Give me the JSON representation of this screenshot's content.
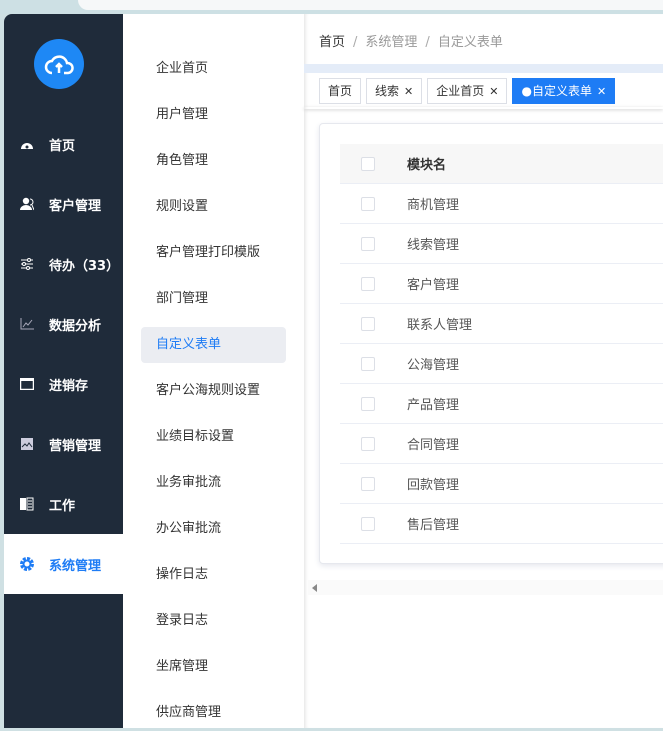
{
  "sidebar": {
    "items": [
      {
        "label": "首页",
        "icon": "dashboard-icon"
      },
      {
        "label": "客户管理",
        "icon": "users-icon"
      },
      {
        "label": "待办（33）",
        "icon": "sliders-icon"
      },
      {
        "label": "数据分析",
        "icon": "chart-line-icon"
      },
      {
        "label": "进销存",
        "icon": "folder-icon"
      },
      {
        "label": "营销管理",
        "icon": "image-icon"
      },
      {
        "label": "工作",
        "icon": "book-icon"
      },
      {
        "label": "系统管理",
        "icon": "gear-icon",
        "active": true
      }
    ]
  },
  "submenu": {
    "items": [
      "企业首页",
      "用户管理",
      "角色管理",
      "规则设置",
      "客户管理打印模版",
      "部门管理",
      "自定义表单",
      "客户公海规则设置",
      "业绩目标设置",
      "业务审批流",
      "办公审批流",
      "操作日志",
      "登录日志",
      "坐席管理",
      "供应商管理"
    ],
    "active": "自定义表单"
  },
  "breadcrumb": [
    "首页",
    "系统管理",
    "自定义表单"
  ],
  "tabs": [
    {
      "label": "首页",
      "closable": false
    },
    {
      "label": "线索",
      "closable": true
    },
    {
      "label": "企业首页",
      "closable": true
    },
    {
      "label": "●自定义表单",
      "closable": true,
      "active": true
    }
  ],
  "table": {
    "header": "模块名",
    "rows": [
      "商机管理",
      "线索管理",
      "客户管理",
      "联系人管理",
      "公海管理",
      "产品管理",
      "合同管理",
      "回款管理",
      "售后管理"
    ]
  },
  "colors": {
    "sidebar": "#1f2b3a",
    "accent": "#1e7cf5",
    "logo": "#1e88f5"
  }
}
